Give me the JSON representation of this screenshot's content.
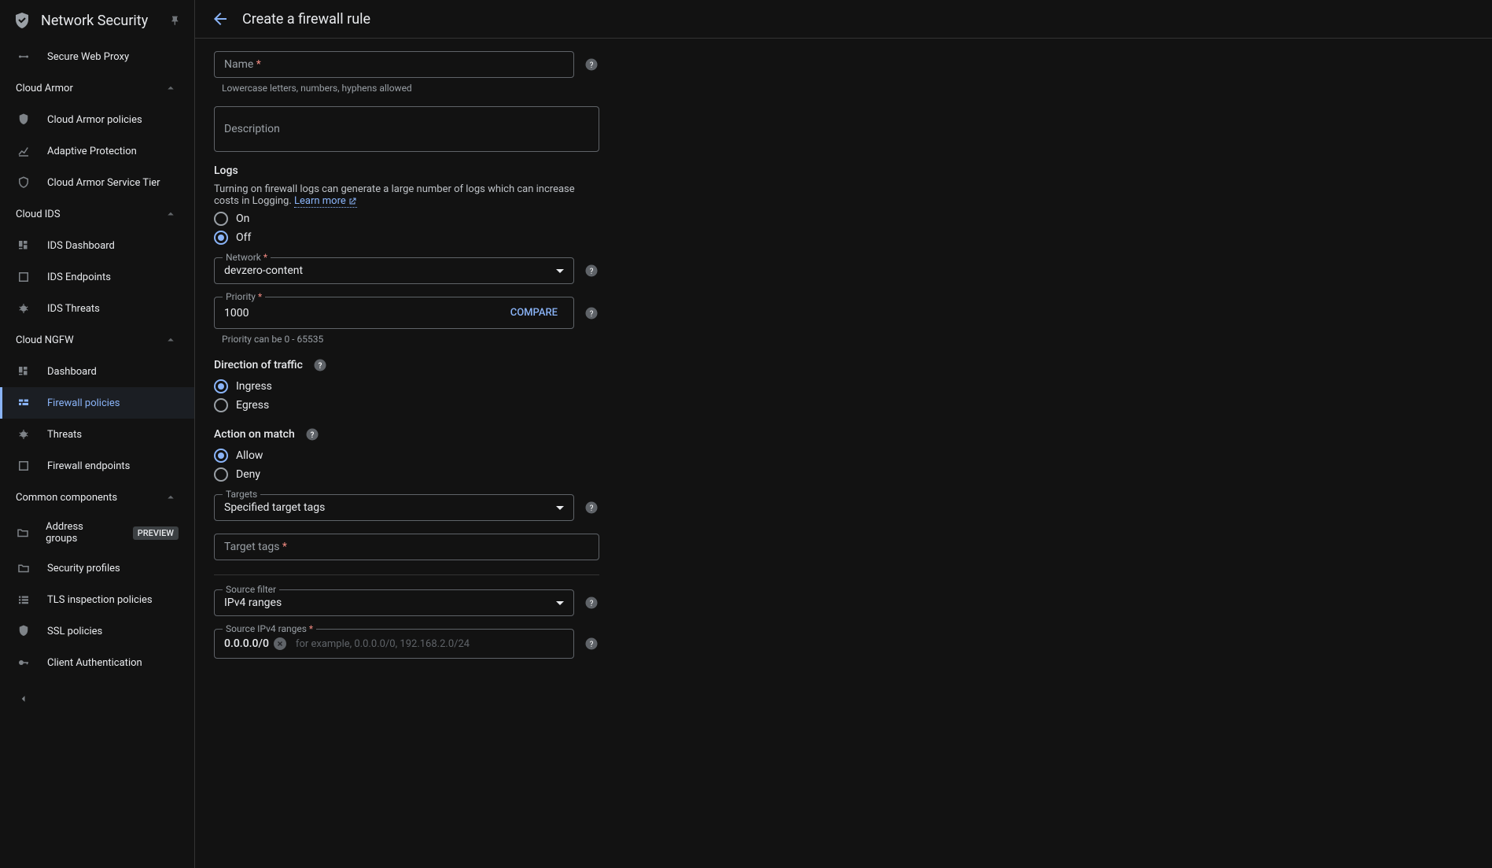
{
  "app": {
    "title": "Network Security"
  },
  "sidebar": {
    "items": [
      {
        "label": "Secure Web Proxy",
        "section": null
      },
      {
        "heading": "Cloud Armor"
      },
      {
        "label": "Cloud Armor policies"
      },
      {
        "label": "Adaptive Protection"
      },
      {
        "label": "Cloud Armor Service Tier"
      },
      {
        "heading": "Cloud IDS"
      },
      {
        "label": "IDS Dashboard"
      },
      {
        "label": "IDS Endpoints"
      },
      {
        "label": "IDS Threats"
      },
      {
        "heading": "Cloud NGFW"
      },
      {
        "label": "Dashboard"
      },
      {
        "label": "Firewall policies",
        "active": true
      },
      {
        "label": "Threats"
      },
      {
        "label": "Firewall endpoints"
      },
      {
        "heading": "Common components"
      },
      {
        "label": "Address groups",
        "badge": "PREVIEW"
      },
      {
        "label": "Security profiles"
      },
      {
        "label": "TLS inspection policies"
      },
      {
        "label": "SSL policies"
      },
      {
        "label": "Client Authentication"
      }
    ]
  },
  "page": {
    "title": "Create a firewall rule"
  },
  "form": {
    "name": {
      "label": "Name",
      "value": "",
      "helper": "Lowercase letters, numbers, hyphens allowed"
    },
    "description": {
      "label": "Description",
      "value": ""
    },
    "logs": {
      "title": "Logs",
      "note": "Turning on firewall logs can generate a large number of logs which can increase costs in Logging. ",
      "learn_more": "Learn more",
      "options": {
        "on": "On",
        "off": "Off"
      },
      "selected": "off"
    },
    "network": {
      "label": "Network",
      "value": "devzero-content"
    },
    "priority": {
      "label": "Priority",
      "value": "1000",
      "compare": "COMPARE",
      "helper": "Priority can be 0 - 65535"
    },
    "direction": {
      "title": "Direction of traffic",
      "options": {
        "ingress": "Ingress",
        "egress": "Egress"
      },
      "selected": "ingress"
    },
    "action": {
      "title": "Action on match",
      "options": {
        "allow": "Allow",
        "deny": "Deny"
      },
      "selected": "allow"
    },
    "targets": {
      "label": "Targets",
      "value": "Specified target tags"
    },
    "target_tags": {
      "label": "Target tags",
      "value": ""
    },
    "source_filter": {
      "label": "Source filter",
      "value": "IPv4 ranges"
    },
    "source_ranges": {
      "label": "Source IPv4 ranges",
      "chip": "0.0.0.0/0",
      "example": "for example, 0.0.0.0/0, 192.168.2.0/24"
    }
  }
}
